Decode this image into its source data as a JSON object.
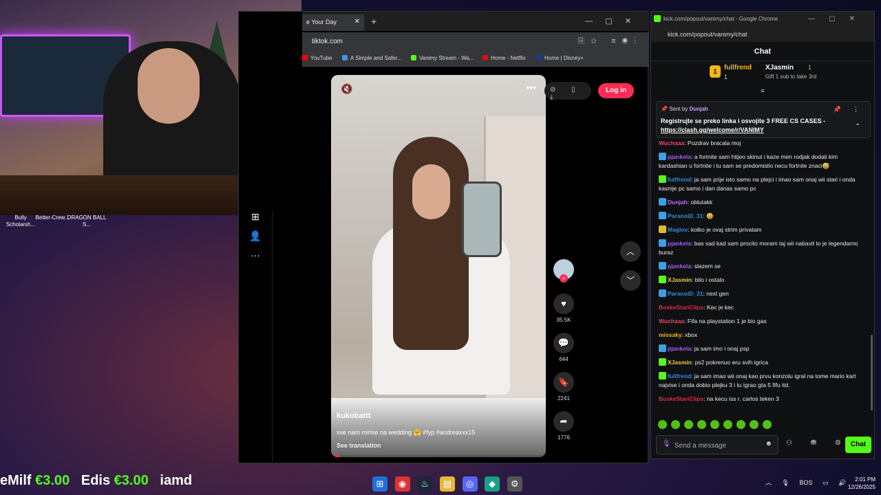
{
  "desktop": {
    "icons": [
      "Bully Scholarsh...",
      "Better-Crew...",
      "DRAGON BALL S..."
    ]
  },
  "tiktok_window": {
    "tab_title": "e Your Day",
    "url": "tiktok.com",
    "bookmarks": [
      "YouTube",
      "A Simple and Safer...",
      "Vanimy Stream - Wa...",
      "Home - Netflix",
      "Home | Disney+"
    ],
    "login_label": "Log in",
    "video": {
      "author": "kukobattt",
      "caption": "sve nam mirise na wedding 🤗 #fyp #andreaxxx15",
      "translation_label": "See translation",
      "progress": 0.04
    },
    "actions": {
      "likes": "35.5K",
      "comments": "644",
      "saves": "2241",
      "shares": "1776"
    },
    "icons": {
      "mute": "🔇",
      "more": "•••",
      "heart": "♥",
      "comment": "💬",
      "bookmark": "🔖",
      "share": "➦",
      "up": "︿",
      "down": "﹀",
      "add": "⊞",
      "profile": "👤",
      "nav_more": "···",
      "tools": "⊘ ▯ ⤓"
    }
  },
  "chat_window": {
    "window_title": "kick.com/popout/vanimy/chat - Google Chrome",
    "url": "kick.com/popout/vanimy/chat",
    "header": "Chat",
    "leaderboard": {
      "first_name": "fullfrend",
      "first_count": "1",
      "second_name": "XJasmin",
      "second_count": "1",
      "gift_text": "Gift 1 sub to take 3rd",
      "rank": "1"
    },
    "pinned": {
      "sent_by_label": "Sent by",
      "sender": "Dunjah",
      "message": "Registrujte se preko linka i osvojite 3 FREE CS CASES",
      "link": "https://clash.gg/welcome/r/VANIMY"
    },
    "messages": [
      {
        "user": "Wuchaaa",
        "text": ": Pozdrav bracala moj",
        "color": "#e94560",
        "badge": ""
      },
      {
        "user": "pjankela",
        "text": ": a fortnite sam htijeo skinut i kaze men rodjak dodali kim kardashian u fortnite i tu sam se predomislio necu fortnite znaci😅",
        "color": "#a55ff0",
        "badge": "blue"
      },
      {
        "user": "fullfrend",
        "text": ": ja sam prije isto samo na plejci i imao sam onaj wii stari i onda kasnije pc samo i dan danas samo pc",
        "color": "#2b8de0",
        "badge": "green"
      },
      {
        "user": "Dunjah",
        "text": ": oblutakk",
        "color": "#c070ff",
        "badge": "blue"
      },
      {
        "user": "ParanoiD_31",
        "text": ": 😀",
        "color": "#2b8de0",
        "badge": "blue"
      },
      {
        "user": "Maglov",
        "text": ": kolko je ovaj strim privatam",
        "color": "#2b8de0",
        "badge": "gold"
      },
      {
        "user": "pjankela",
        "text": ": bas sad kad sam procito moram taj wii nabavit to je legendarno buraz",
        "color": "#a55ff0",
        "badge": "blue"
      },
      {
        "user": "pjankela",
        "text": ": slazem se",
        "color": "#a55ff0",
        "badge": "blue"
      },
      {
        "user": "XJasmin",
        "text": ": bilo i ostalo",
        "color": "#f2d03b",
        "badge": "green"
      },
      {
        "user": "ParanoiD_31",
        "text": ": next gen",
        "color": "#2b8de0",
        "badge": "blue"
      },
      {
        "user": "BoskeStariClips",
        "text": ": Kec je kec",
        "color": "#e02b4a",
        "badge": ""
      },
      {
        "user": "Wuchaaa",
        "text": ": Fifa na playstation 1 je bio gas",
        "color": "#e94560",
        "badge": ""
      },
      {
        "user": "missaky",
        "text": ": xbox",
        "color": "#f2b616",
        "badge": ""
      },
      {
        "user": "pjankela",
        "text": ": ja sam imo i onaj psp",
        "color": "#a55ff0",
        "badge": "blue"
      },
      {
        "user": "XJasmin",
        "text": ": ps2 pokrenuo eru svih igrica",
        "color": "#f2d03b",
        "badge": "green"
      },
      {
        "user": "fullfrend",
        "text": ": ja sam imao wii onaj kao prvu konzolu igral na tome mario kart najvise i onda dobio plejku 3 i tu igrao gta 5 fifu itd.",
        "color": "#2b8de0",
        "badge": "green"
      },
      {
        "user": "BoskeStariClips",
        "text": ": na kecu iss r. carlos teken 3",
        "color": "#e02b4a",
        "badge": ""
      }
    ],
    "input_placeholder": "Send a message",
    "send_label": "Chat",
    "icons": {
      "mic": "🎙",
      "emoji": "☻",
      "tools": "⚇ ⛃ ⚙"
    }
  },
  "ticker": {
    "items": [
      {
        "name": "eMilf",
        "amount": "€3.00"
      },
      {
        "name": "Edis",
        "amount": "€3.00"
      },
      {
        "name": "iamd",
        "amount": ""
      }
    ]
  },
  "taskbar": {
    "language": "BOS",
    "time": "2:01 PM",
    "date": "12/26/2025"
  }
}
